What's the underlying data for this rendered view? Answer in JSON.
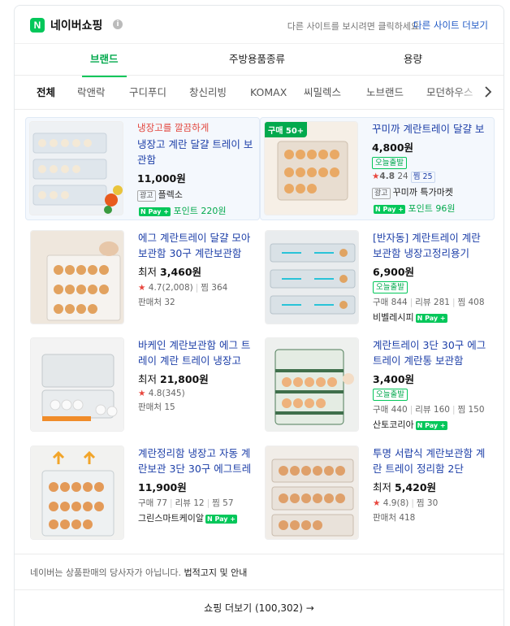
{
  "header": {
    "logo_letter": "N",
    "title": "네이버쇼핑",
    "info_icon": "i",
    "hint": "다른 사이트를 보시려면 클릭하세요",
    "more_sites": "다른 사이트 더보기"
  },
  "tabs": [
    "브랜드",
    "주방용품종류",
    "용량"
  ],
  "chips": [
    "전체",
    "락앤락",
    "구디푸디",
    "창신리빙",
    "KOMAX",
    "씨밀렉스",
    "노브랜드",
    "모던하우스"
  ],
  "chip_next_icon": "chevron-right-icon",
  "items": [
    {
      "badge": "",
      "promo": "냉장고를 깔끔하게",
      "title": "냉장고 계란 달걀 트레이 보관함",
      "price_prefix": "",
      "price": "11,000원",
      "ad_label": "광고",
      "seller": "플렉소",
      "pay": "N Pay +",
      "points": "포인트 220원"
    },
    {
      "badge": "구매 50+",
      "title": "꾸미까 계란트레이 달걀 보관함",
      "price": "4,800원",
      "sale": "오늘출발",
      "rating": "4.8",
      "reviews": "24",
      "zzim": "찜 25",
      "ad_label": "광고",
      "seller": "꾸미까 특가마켓",
      "pay": "N Pay +",
      "points": "포인트 96원"
    },
    {
      "title": "에그 계란트레이 달걀 모아 보관함 30구 계란보관함",
      "price_prefix": "최저",
      "price": "3,460원",
      "rating": "4.7",
      "reviews": "(2,008)",
      "zzim": "찜 364",
      "sellers": "판매처 32"
    },
    {
      "title": "[반자동] 계란트레이 계란 보관함 냉장고정리용기",
      "price": "6,900원",
      "sale": "오늘출발",
      "stats": [
        "구매 844",
        "리뷰 281",
        "찜 408"
      ],
      "seller": "비벨레시피",
      "pay": "N Pay +"
    },
    {
      "title": "바케인 계란보관함 에그 트레이 계란 트레이 냉장고",
      "price_prefix": "최저",
      "price": "21,800원",
      "rating": "4.8",
      "reviews": "(345)",
      "sellers": "판매처 15"
    },
    {
      "title": "계란트레이 3단 30구 에그트레이 계란통 보관함",
      "price": "3,400원",
      "sale": "오늘출발",
      "stats": [
        "구매 440",
        "리뷰 160",
        "찜 150"
      ],
      "seller": "산토코리아",
      "pay": "N Pay +"
    },
    {
      "title": "계란정리함 냉장고 자동 계란보관 3단 30구 에그트레이",
      "price": "11,900원",
      "stats": [
        "구매 77",
        "리뷰 12",
        "찜 57"
      ],
      "seller": "그린스마트케이알",
      "pay": "N Pay +"
    },
    {
      "title": "투명 서랍식 계란보관함 계란 트레이 정리함 2단",
      "price_prefix": "최저",
      "price": "5,420원",
      "rating": "4.9",
      "reviews": "(8)",
      "zzim": "찜 30",
      "sellers": "판매처 418"
    }
  ],
  "footer": {
    "disclaimer": "네이버는 상품판매의 당사자가 아닙니다.",
    "legal_link": "법적고지 및 안내"
  },
  "more_shopping": "쇼핑 더보기 (100,302) →",
  "colors": {
    "accent": "#03c75a",
    "link": "#1d3fa8",
    "promo": "#e2443c"
  }
}
